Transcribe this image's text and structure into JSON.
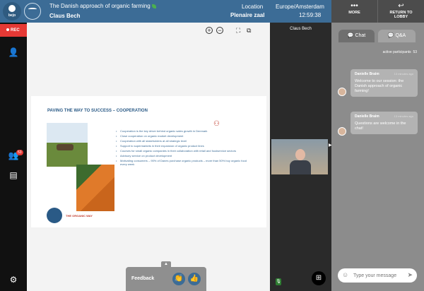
{
  "header": {
    "logo_text": "bejo",
    "title": "The Danish approach of organic farming",
    "speaker": "Claus Bech",
    "location_label": "Location",
    "location_value": "Plenaire zaal",
    "timezone": "Europe/Amsterdam",
    "time": "12:59:38"
  },
  "top_buttons": {
    "more_label": "MORE",
    "lobby_label_1": "RETURN TO",
    "lobby_label_2": "LOBBY"
  },
  "sidebar": {
    "rec_label": "REC",
    "participants_badge": "53"
  },
  "slide": {
    "title": "PAVING  THE WAY TO SUCCESS – COOPERATION",
    "bullets": [
      "Cooperation is the key driver behind organic sales growth  in Denmark",
      "Close cooperation on organic market development",
      "Cooperation with all stakeholders at all strategic  level",
      "Support to supermarkets in their expansion of organic product lines",
      "Courses for small organic companies in their collaboration with retail and foodservice sectors",
      "Advisory service on product development",
      "Motivating consumers – 90% of Danes purchase organic products – more than 50% buy organic food every week"
    ],
    "logo_text": "THE ORGANIC WAY"
  },
  "feedback": {
    "label": "Feedback"
  },
  "video": {
    "name": "Claus Bech"
  },
  "chat": {
    "tab_chat": "Chat",
    "tab_qa": "Q&A",
    "active_participants_label": "active participants",
    "active_participants_count": "53",
    "messages": [
      {
        "name": "Danielle Braim",
        "time": "13 minutes ago",
        "text": "Welcome to our session: the Danish approach of organic farming!"
      },
      {
        "name": "Danielle Braim",
        "time": "13 minutes ago",
        "text": "Questions are welcome in the chat!"
      }
    ],
    "input_placeholder": "Type your message"
  }
}
